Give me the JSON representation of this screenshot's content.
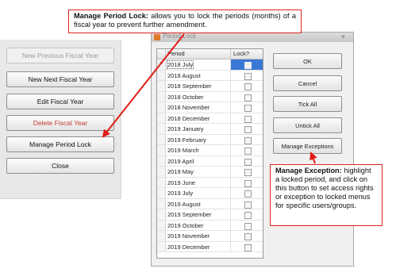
{
  "fiscal_panel": {
    "buttons": [
      {
        "label": "New Previous Fiscal Year",
        "state": "disabled"
      },
      {
        "label": "New Next Fiscal Year",
        "state": "normal"
      },
      {
        "label": "Edit Fiscal Year",
        "state": "normal"
      },
      {
        "label": "Delete Fiscal Year",
        "state": "danger"
      },
      {
        "label": "Manage Period Lock",
        "state": "normal"
      },
      {
        "label": "Close",
        "state": "normal"
      }
    ]
  },
  "period_lock_window": {
    "title": "Period Lock",
    "close_glyph": "×",
    "grid": {
      "columns": [
        "Period",
        "Lock?"
      ],
      "selected_row_marker": ">",
      "rows": [
        "2018 July",
        "2018 August",
        "2018 September",
        "2018 October",
        "2018 November",
        "2018 December",
        "2019 January",
        "2019 February",
        "2019 March",
        "2019 April",
        "2019 May",
        "2019 June",
        "2019 July",
        "2019 August",
        "2019 September",
        "2019 October",
        "2019 November",
        "2019 December"
      ],
      "selected_index": 0
    },
    "buttons": {
      "ok": "OK",
      "cancel": "Cancel",
      "tick_all": "Tick All",
      "untick_all": "Untick All",
      "manage_exceptions": "Manage Exceptions"
    }
  },
  "callouts": {
    "period_lock": {
      "heading": "Manage Period Lock:",
      "body": "allows you to lock the periods (months) of a fiscal year to prevent further amendment."
    },
    "exceptions": {
      "heading": "Manage Exception:",
      "body": "highlight a locked period, and click on this button to set access rights or exception to locked menus for specific users/groups."
    }
  },
  "colors": {
    "callout_border": "#d9231d",
    "arrow": "#e21b16",
    "selection": "#3a78d6",
    "delete_text": "#c0392b"
  }
}
